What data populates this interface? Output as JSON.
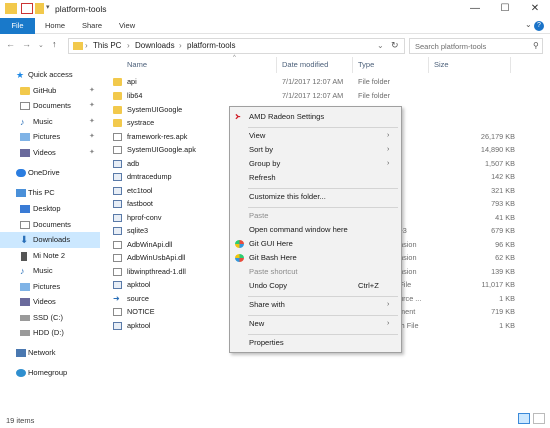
{
  "window": {
    "title": "platform-tools",
    "buttons": {
      "minimize": "—",
      "maximize": "☐",
      "close": "✕"
    }
  },
  "ribbon": {
    "tabs": [
      "File",
      "Home",
      "Share",
      "View"
    ],
    "expand": "⌄",
    "help": "?"
  },
  "nav": {
    "back": "←",
    "forward": "→",
    "recent": "⌄",
    "up": "↑",
    "path": [
      "This PC",
      "Downloads",
      "platform-tools"
    ],
    "sep": "›",
    "refresh": "↻",
    "search_placeholder": "Search platform-tools"
  },
  "sidebar": [
    {
      "label": "Quick access",
      "icon": "star-icon",
      "color": "#1e88e5"
    },
    {
      "label": "GitHub",
      "icon": "folder-icon",
      "pin": true
    },
    {
      "label": "Documents",
      "icon": "documents-icon",
      "pin": true
    },
    {
      "label": "Music",
      "icon": "music-icon",
      "pin": true
    },
    {
      "label": "Pictures",
      "icon": "pictures-icon",
      "pin": true
    },
    {
      "label": "Videos",
      "icon": "videos-icon",
      "pin": true
    },
    {
      "label": "OneDrive",
      "icon": "onedrive-icon"
    },
    {
      "label": "This PC",
      "icon": "computer-icon"
    },
    {
      "label": "Desktop",
      "icon": "desktop-icon"
    },
    {
      "label": "Documents",
      "icon": "documents-icon"
    },
    {
      "label": "Downloads",
      "icon": "downloads-icon",
      "selected": true
    },
    {
      "label": "Mi Note 2",
      "icon": "phone-icon"
    },
    {
      "label": "Music",
      "icon": "music-icon"
    },
    {
      "label": "Pictures",
      "icon": "pictures-icon"
    },
    {
      "label": "Videos",
      "icon": "videos-icon"
    },
    {
      "label": "SSD (C:)",
      "icon": "drive-icon"
    },
    {
      "label": "HDD (D:)",
      "icon": "drive-icon"
    },
    {
      "label": "Network",
      "icon": "network-icon"
    },
    {
      "label": "Homegroup",
      "icon": "homegroup-icon"
    }
  ],
  "columns": {
    "name": "Name",
    "date": "Date modified",
    "type": "Type",
    "size": "Size",
    "sort_arrow": "^"
  },
  "files": [
    {
      "name": "api",
      "date": "7/1/2017 12:07 AM",
      "type": "File folder",
      "size": "",
      "kind": "folder"
    },
    {
      "name": "lib64",
      "date": "7/1/2017 12:07 AM",
      "type": "File folder",
      "size": "",
      "kind": "folder"
    },
    {
      "name": "SystemUIGoogle",
      "date": "",
      "type": "",
      "size": "",
      "kind": "folder"
    },
    {
      "name": "systrace",
      "date": "",
      "type": "",
      "size": "",
      "kind": "folder"
    },
    {
      "name": "framework-res.apk",
      "date": "",
      "type": "",
      "size": "26,179 KB",
      "kind": "doc"
    },
    {
      "name": "SystemUIGoogle.apk",
      "date": "",
      "type": "",
      "size": "14,890 KB",
      "kind": "doc"
    },
    {
      "name": "adb",
      "date": "",
      "type": "",
      "size": "1,507 KB",
      "kind": "exe"
    },
    {
      "name": "dmtracedump",
      "date": "",
      "type": "",
      "size": "142 KB",
      "kind": "exe"
    },
    {
      "name": "etc1tool",
      "date": "",
      "type": "",
      "size": "321 KB",
      "kind": "exe"
    },
    {
      "name": "fastboot",
      "date": "",
      "type": "",
      "size": "793 KB",
      "kind": "exe"
    },
    {
      "name": "hprof-conv",
      "date": "",
      "type": "",
      "size": "41 KB",
      "kind": "exe"
    },
    {
      "name": "sqlite3",
      "date": "",
      "type": "ite3",
      "size": "679 KB",
      "kind": "exe"
    },
    {
      "name": "AdbWinApi.dll",
      "date": "",
      "type": "ension",
      "size": "96 KB",
      "kind": "doc"
    },
    {
      "name": "AdbWinUsbApi.dll",
      "date": "",
      "type": "ension",
      "size": "62 KB",
      "kind": "doc"
    },
    {
      "name": "libwinpthread-1.dll",
      "date": "",
      "type": "ension",
      "size": "139 KB",
      "kind": "doc"
    },
    {
      "name": "apktool",
      "date": "",
      "type": "r File",
      "size": "11,017 KB",
      "kind": "exe"
    },
    {
      "name": "source",
      "date": "",
      "type": "ource ...",
      "size": "1 KB",
      "kind": "doc"
    },
    {
      "name": "NOTICE",
      "date": "",
      "type": "ument",
      "size": "719 KB",
      "kind": "doc"
    },
    {
      "name": "apktool",
      "date": "",
      "type": "tch File",
      "size": "1 KB",
      "kind": "exe"
    }
  ],
  "context_menu": {
    "items": [
      {
        "label": "AMD Radeon Settings",
        "icon": "amd-icon"
      },
      {
        "sep": true
      },
      {
        "label": "View",
        "arrow": true
      },
      {
        "label": "Sort by",
        "arrow": true
      },
      {
        "label": "Group by",
        "arrow": true
      },
      {
        "label": "Refresh"
      },
      {
        "sep": true
      },
      {
        "label": "Customize this folder..."
      },
      {
        "sep": true
      },
      {
        "label": "Paste",
        "disabled": true
      },
      {
        "label": "Open command window here"
      },
      {
        "label": "Git GUI Here",
        "icon": "git-gui-icon"
      },
      {
        "label": "Git Bash Here",
        "icon": "git-bash-icon"
      },
      {
        "label": "Paste shortcut",
        "disabled": true
      },
      {
        "label": "Undo Copy",
        "shortcut": "Ctrl+Z"
      },
      {
        "sep": true
      },
      {
        "label": "Share with",
        "arrow": true
      },
      {
        "sep": true
      },
      {
        "label": "New",
        "arrow": true
      },
      {
        "sep": true
      },
      {
        "label": "Properties"
      }
    ],
    "arrow": "›"
  },
  "status": {
    "count": "19 items"
  },
  "colors": {
    "accent": "#1979ca",
    "selected_bg": "#cce8ff"
  }
}
